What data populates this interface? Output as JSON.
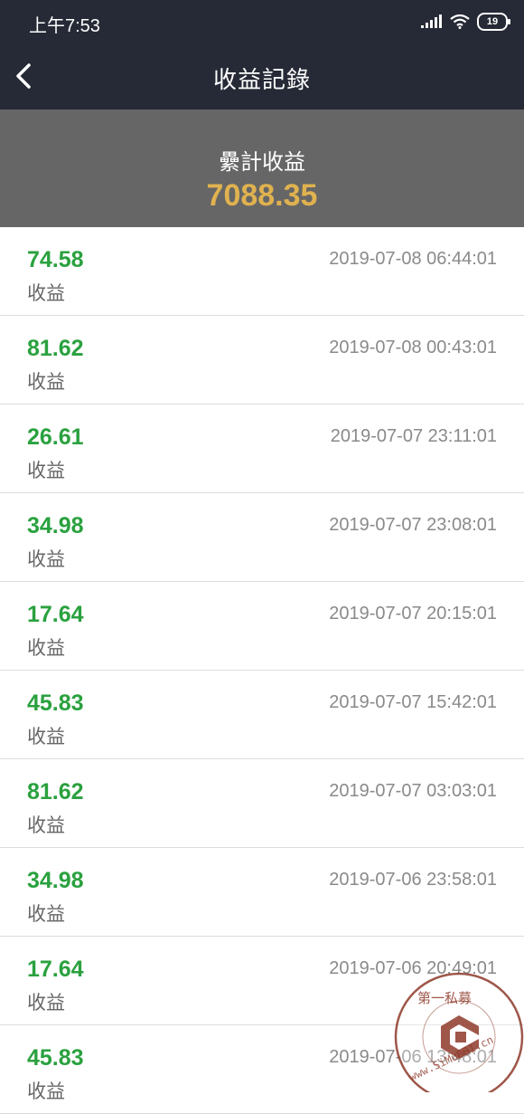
{
  "status_bar": {
    "time": "上午7:53",
    "battery": "19"
  },
  "nav": {
    "title": "收益記錄"
  },
  "summary": {
    "label": "纍計收益",
    "value": "7088.35"
  },
  "records": [
    {
      "amount": "74.58",
      "type": "收益",
      "time": "2019-07-08 06:44:01"
    },
    {
      "amount": "81.62",
      "type": "收益",
      "time": "2019-07-08 00:43:01"
    },
    {
      "amount": "26.61",
      "type": "收益",
      "time": "2019-07-07 23:11:01"
    },
    {
      "amount": "34.98",
      "type": "收益",
      "time": "2019-07-07 23:08:01"
    },
    {
      "amount": "17.64",
      "type": "收益",
      "time": "2019-07-07 20:15:01"
    },
    {
      "amount": "45.83",
      "type": "收益",
      "time": "2019-07-07 15:42:01"
    },
    {
      "amount": "81.62",
      "type": "收益",
      "time": "2019-07-07 03:03:01"
    },
    {
      "amount": "34.98",
      "type": "收益",
      "time": "2019-07-06 23:58:01"
    },
    {
      "amount": "17.64",
      "type": "收益",
      "time": "2019-07-06 20:49:01"
    },
    {
      "amount": "45.83",
      "type": "收益",
      "time": "2019-07-06 13:48:01"
    }
  ],
  "watermark": {
    "text": "www.SiMu001.cn",
    "chars": "第一私募"
  }
}
